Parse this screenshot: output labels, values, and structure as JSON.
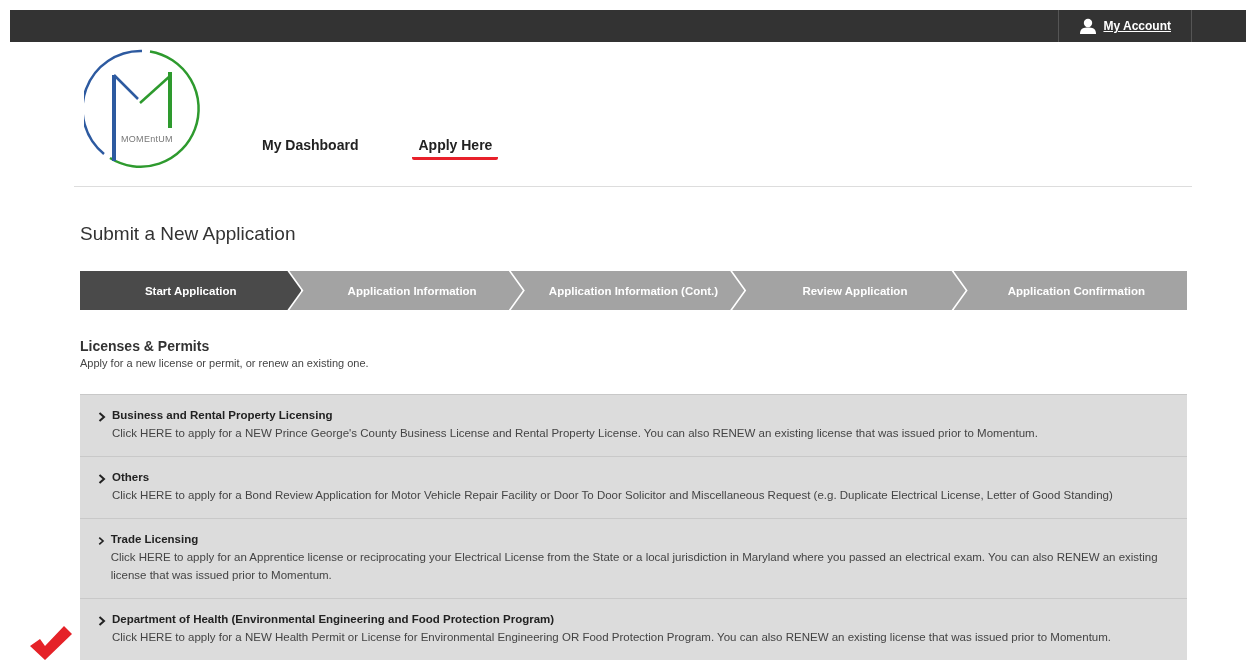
{
  "top_bar": {
    "account_link": "My Account"
  },
  "logo": {
    "text": "MOMEntUM"
  },
  "nav": [
    {
      "label": "My Dashboard",
      "selected": false
    },
    {
      "label": "Apply Here",
      "selected": true
    }
  ],
  "page_title": "Submit a New Application",
  "steps": [
    {
      "label": "Start Application",
      "selected": true
    },
    {
      "label": "Application Information",
      "selected": false
    },
    {
      "label": "Application Information (Cont.)",
      "selected": false
    },
    {
      "label": "Review Application",
      "selected": false
    },
    {
      "label": "Application Confirmation",
      "selected": false
    }
  ],
  "section": {
    "title": "Licenses & Permits",
    "subtitle": "Apply for a new license or permit, or renew an existing one."
  },
  "categories": [
    {
      "title": "Business and Rental Property Licensing",
      "description": "Click HERE to apply for a NEW Prince George's County Business License and Rental Property License. You can also RENEW an existing license that was issued prior to Momentum.",
      "expanded": false
    },
    {
      "title": "Others",
      "description": "Click HERE to apply for a Bond Review Application for Motor Vehicle Repair Facility or Door To Door Solicitor and Miscellaneous Request (e.g. Duplicate Electrical License, Letter of Good Standing)",
      "expanded": false
    },
    {
      "title": "Trade Licensing",
      "description": "Click HERE to apply for an Apprentice license or reciprocating your Electrical License from the State or a local jurisdiction in Maryland where you passed an electrical exam. You can also RENEW an existing license that was issued prior to Momentum.",
      "expanded": false
    },
    {
      "title": "Department of Health (Environmental Engineering and Food Protection Program)",
      "description": "Click HERE to apply for a NEW Health Permit or License for Environmental Engineering OR Food Protection Program. You can also RENEW an existing license that was issued prior to Momentum.",
      "expanded": false
    }
  ]
}
